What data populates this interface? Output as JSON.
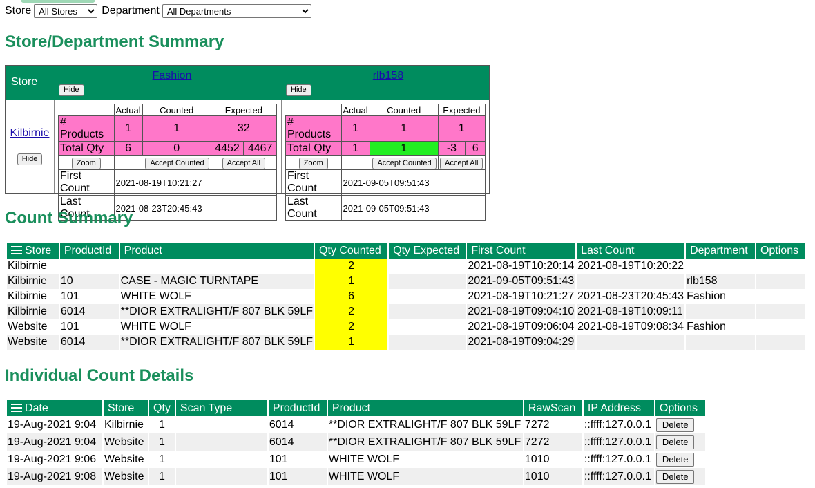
{
  "filters": {
    "store_label": "Store",
    "store_value": "All Stores",
    "department_label": "Department",
    "department_value": "All Departments"
  },
  "summary": {
    "title": "Store/Department Summary",
    "store_header": "Store",
    "hide_label": "Hide",
    "departments": [
      {
        "name": "Fashion",
        "col_actual": "Actual",
        "col_counted": "Counted",
        "col_expected": "Expected",
        "row_products": "# Products",
        "products_actual": "1",
        "products_counted": "1",
        "products_expected": "32",
        "row_qty": "Total Qty",
        "qty_actual": "6",
        "qty_counted": "0",
        "qty_expected_a": "4452",
        "qty_expected_b": "4467",
        "zoom": "Zoom",
        "accept_counted": "Accept Counted",
        "accept_all": "Accept All",
        "first_count_label": "First Count",
        "first_count": "2021-08-19T10:21:27",
        "last_count_label": "Last Count",
        "last_count": "2021-08-23T20:45:43"
      },
      {
        "name": "rlb158",
        "col_actual": "Actual",
        "col_counted": "Counted",
        "col_expected": "Expected",
        "row_products": "# Products",
        "products_actual": "1",
        "products_counted": "1",
        "products_expected": "1",
        "row_qty": "Total Qty",
        "qty_actual": "1",
        "qty_counted": "1",
        "qty_expected_a": "-3",
        "qty_expected_b": "6",
        "zoom": "Zoom",
        "accept_counted": "Accept Counted",
        "accept_all": "Accept All",
        "first_count_label": "First Count",
        "first_count": "2021-09-05T09:51:43",
        "last_count_label": "Last Count",
        "last_count": "2021-09-05T09:51:43"
      }
    ],
    "store": "Kilbirnie"
  },
  "count_summary": {
    "title": "Count Summary",
    "columns": [
      "Store",
      "ProductId",
      "Product",
      "Qty Counted",
      "Qty Expected",
      "First Count",
      "Last Count",
      "Department",
      "Options"
    ],
    "rows": [
      [
        "Kilbirnie",
        "",
        "",
        "2",
        "",
        "2021-08-19T10:20:14",
        "2021-08-19T10:20:22",
        "",
        ""
      ],
      [
        "Kilbirnie",
        "10",
        "CASE - MAGIC TURNTAPE",
        "1",
        "",
        "2021-09-05T09:51:43",
        "",
        "rlb158",
        ""
      ],
      [
        "Kilbirnie",
        "101",
        "WHITE WOLF",
        "6",
        "",
        "2021-08-19T10:21:27",
        "2021-08-23T20:45:43",
        "Fashion",
        ""
      ],
      [
        "Kilbirnie",
        "6014",
        "**DIOR EXTRALIGHT/F 807 BLK 59LF",
        "2",
        "",
        "2021-08-19T09:04:10",
        "2021-08-19T10:09:11",
        "",
        ""
      ],
      [
        "Website",
        "101",
        "WHITE WOLF",
        "2",
        "",
        "2021-08-19T09:06:04",
        "2021-08-19T09:08:34",
        "Fashion",
        ""
      ],
      [
        "Website",
        "6014",
        "**DIOR EXTRALIGHT/F 807 BLK 59LF",
        "1",
        "",
        "2021-08-19T09:04:29",
        "",
        "",
        ""
      ]
    ]
  },
  "details": {
    "title": "Individual Count Details",
    "columns": [
      "Date",
      "Store",
      "Qty",
      "Scan Type",
      "ProductId",
      "Product",
      "RawScan",
      "IP Address",
      "Options"
    ],
    "delete_label": "Delete",
    "rows": [
      [
        "19-Aug-2021 9:04",
        "Kilbirnie",
        "1",
        "",
        "6014",
        "**DIOR EXTRALIGHT/F 807 BLK 59LF",
        "7272",
        "::ffff:127.0.0.1"
      ],
      [
        "19-Aug-2021 9:04",
        "Website",
        "1",
        "",
        "6014",
        "**DIOR EXTRALIGHT/F 807 BLK 59LF",
        "7272",
        "::ffff:127.0.0.1"
      ],
      [
        "19-Aug-2021 9:06",
        "Website",
        "1",
        "",
        "101",
        "WHITE WOLF",
        "1010",
        "::ffff:127.0.0.1"
      ],
      [
        "19-Aug-2021 9:08",
        "Website",
        "1",
        "",
        "101",
        "WHITE WOLF",
        "1010",
        "::ffff:127.0.0.1"
      ]
    ]
  },
  "colors": {
    "accent": "#008c5e",
    "heading": "#1a8f5c",
    "pink": "#ff77c9",
    "green": "#22ee22",
    "yellow": "#ffff00"
  }
}
